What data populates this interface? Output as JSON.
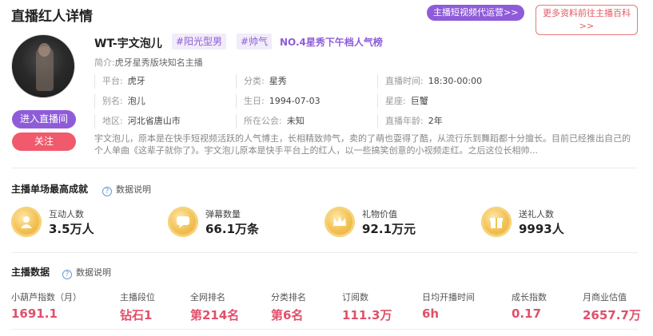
{
  "header": {
    "title": "直播红人详情",
    "promo_button": "主播短视频代运营>>",
    "more_button_line1": "更多资料前往主播百科",
    "more_button_line2": ">>"
  },
  "profile": {
    "name": "WT-宇文泡儿",
    "tags": [
      "#阳光型男",
      "#帅气"
    ],
    "rank": "NO.4星秀下午档人气榜",
    "intro_label": "简介:",
    "intro": "虎牙星秀版块知名主播",
    "enter_button": "进入直播间",
    "follow_button": "关注",
    "info": {
      "platform_label": "平台:",
      "platform": "虎牙",
      "category_label": "分类:",
      "category": "星秀",
      "time_label": "直播时间:",
      "time": "18:30-00:00",
      "alias_label": "别名:",
      "alias": "泡儿",
      "birthday_label": "生日:",
      "birthday": "1994-07-03",
      "zodiac_label": "星座:",
      "zodiac": "巨蟹",
      "region_label": "地区:",
      "region": "河北省唐山市",
      "guild_label": "所在公会:",
      "guild": "未知",
      "years_label": "直播年龄:",
      "years": "2年"
    },
    "description": "宇文泡儿，原本是在快手短视频活跃的人气博主，长相精致帅气，卖的了萌也耍得了酷，从流行乐到舞蹈都十分擅长。目前已经推出自己的个人单曲《这辈子就你了》。宇文泡儿原本是快手平台上的红人，以一些搞笑创意的小视频走红。之后这位长相帅..."
  },
  "achievements": {
    "title": "主播单场最高成就",
    "help": "数据说明",
    "items": [
      {
        "label": "互动人数",
        "value": "3.5万人",
        "icon": "people-icon"
      },
      {
        "label": "弹幕数量",
        "value": "66.1万条",
        "icon": "chat-icon"
      },
      {
        "label": "礼物价值",
        "value": "92.1万元",
        "icon": "crown-icon"
      },
      {
        "label": "送礼人数",
        "value": "9993人",
        "icon": "gift-icon"
      }
    ]
  },
  "stats": {
    "title": "主播数据",
    "help": "数据说明",
    "items": [
      {
        "label": "小葫芦指数（月）",
        "value": "1691.1"
      },
      {
        "label": "主播段位",
        "value": "钻石1"
      },
      {
        "label": "全网排名",
        "value": "第214名"
      },
      {
        "label": "分类排名",
        "value": "第6名"
      },
      {
        "label": "订阅数",
        "value": "111.3万"
      },
      {
        "label": "日均开播时间",
        "value": "6h"
      },
      {
        "label": "成长指数",
        "value": "0.17"
      },
      {
        "label": "月商业估值",
        "value": "2657.7万"
      }
    ]
  },
  "colors": {
    "accent_purple": "#8e5cd9",
    "accent_red": "#e0506a",
    "coin_gold": "#f3c45a"
  }
}
